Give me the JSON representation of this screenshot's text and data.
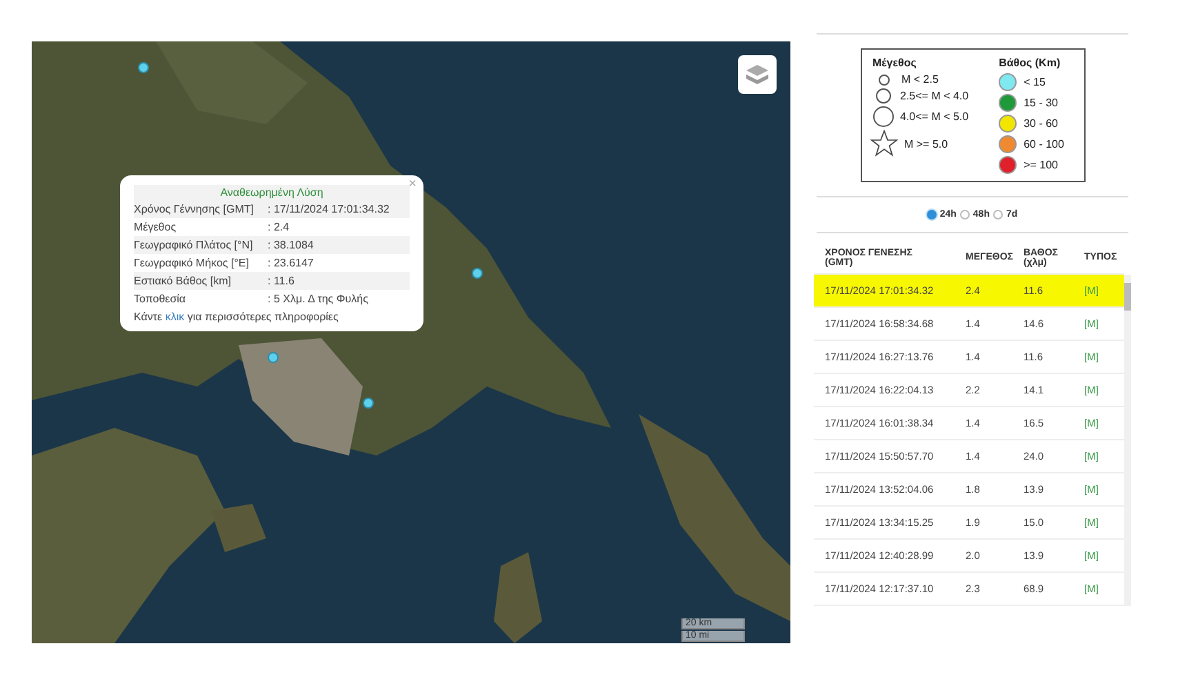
{
  "map": {
    "popup": {
      "title": "Αναθεωρημένη Λύση",
      "rows": [
        {
          "label": "Χρόνος Γέννησης [GMT]",
          "value": ": 17/11/2024 17:01:34.32"
        },
        {
          "label": "Μέγεθος",
          "value": ": 2.4"
        },
        {
          "label": "Γεωγραφικό Πλάτος [°N]",
          "value": ": 38.1084"
        },
        {
          "label": "Γεωγραφικό Μήκος [°E]",
          "value": ": 23.6147"
        },
        {
          "label": "Εστιακό Βάθος [km]",
          "value": ": 11.6"
        },
        {
          "label": "Τοποθεσία",
          "value": ": 5 Χλμ. Δ της Φυλής"
        }
      ],
      "footer": "Κάντε **κλικ** για περισσότερες πληροφορίες",
      "close": "×"
    },
    "scale": [
      "20 km",
      "10 mi"
    ]
  },
  "legend": {
    "magnitude_title": "Μέγεθος",
    "depth_title": "Βάθος (Km)",
    "magnitude": [
      {
        "kind": "small",
        "label": "M < 2.5"
      },
      {
        "kind": "medium",
        "label": "2.5<= M < 4.0"
      },
      {
        "kind": "large",
        "label": "4.0<= M < 5.0"
      },
      {
        "kind": "star",
        "label": "M >= 5.0"
      }
    ],
    "depth": [
      {
        "color": "#7fe8f0",
        "label": "< 15"
      },
      {
        "color": "#1f9a3a",
        "label": "15 - 30"
      },
      {
        "color": "#f2e600",
        "label": "30 - 60"
      },
      {
        "color": "#f08a30",
        "label": "60 - 100"
      },
      {
        "color": "#e0202a",
        "label": ">= 100"
      }
    ]
  },
  "range": [
    {
      "label": "24h",
      "selected": true
    },
    {
      "label": "48h",
      "selected": false
    },
    {
      "label": "7d",
      "selected": false
    }
  ],
  "table": {
    "columns": [
      "ΧΡΟΝΟΣ ΓΕΝΕΣΗΣ (GMT)",
      "ΜΕΓΕΘΟΣ",
      "ΒΑΘΟΣ (χλμ)",
      "ΤΥΠΟΣ"
    ],
    "rows": [
      {
        "time": "17/11/2024 17:01:34.32",
        "magnitude": "2.4",
        "depth": "11.6",
        "type": "[M]",
        "selected": true
      },
      {
        "time": "17/11/2024 16:58:34.68",
        "magnitude": "1.4",
        "depth": "14.6",
        "type": "[M]",
        "selected": false
      },
      {
        "time": "17/11/2024 16:27:13.76",
        "magnitude": "1.4",
        "depth": "11.6",
        "type": "[M]",
        "selected": false
      },
      {
        "time": "17/11/2024 16:22:04.13",
        "magnitude": "2.2",
        "depth": "14.1",
        "type": "[M]",
        "selected": false
      },
      {
        "time": "17/11/2024 16:01:38.34",
        "magnitude": "1.4",
        "depth": "16.5",
        "type": "[M]",
        "selected": false
      },
      {
        "time": "17/11/2024 15:50:57.70",
        "magnitude": "1.4",
        "depth": "24.0",
        "type": "[M]",
        "selected": false
      },
      {
        "time": "17/11/2024 13:52:04.06",
        "magnitude": "1.8",
        "depth": "13.9",
        "type": "[M]",
        "selected": false
      },
      {
        "time": "17/11/2024 13:34:15.25",
        "magnitude": "1.9",
        "depth": "15.0",
        "type": "[M]",
        "selected": false
      },
      {
        "time": "17/11/2024 12:40:28.99",
        "magnitude": "2.0",
        "depth": "13.9",
        "type": "[M]",
        "selected": false
      },
      {
        "time": "17/11/2024 12:17:37.10",
        "magnitude": "2.3",
        "depth": "68.9",
        "type": "[M]",
        "selected": false
      }
    ]
  }
}
